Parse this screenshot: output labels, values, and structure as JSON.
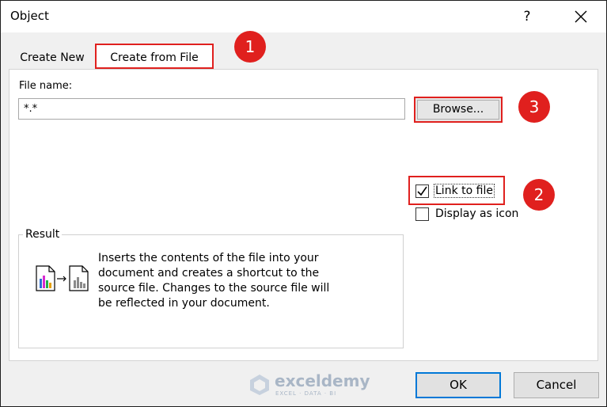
{
  "window": {
    "title": "Object",
    "help_label": "?"
  },
  "tabs": [
    {
      "label": "Create New",
      "selected": false
    },
    {
      "label": "Create from File",
      "selected": true
    }
  ],
  "file_name": {
    "label": "File name:",
    "value": "*.*"
  },
  "browse_label": "Browse...",
  "options": {
    "link_to_file": {
      "label": "Link to file",
      "checked": true
    },
    "display_as_icon": {
      "label": "Display as icon",
      "checked": false
    }
  },
  "result": {
    "label": "Result",
    "text": "Inserts the contents of the file into your\ndocument and creates a shortcut to the\nsource file.  Changes to the source file will\nbe reflected in your document."
  },
  "annotations": [
    "1",
    "2",
    "3"
  ],
  "watermark": {
    "name": "exceldemy",
    "tagline": "EXCEL · DATA · BI"
  },
  "buttons": {
    "ok": "OK",
    "cancel": "Cancel"
  },
  "colors": {
    "highlight": "#e0201e",
    "default_button_border": "#0078d7"
  }
}
